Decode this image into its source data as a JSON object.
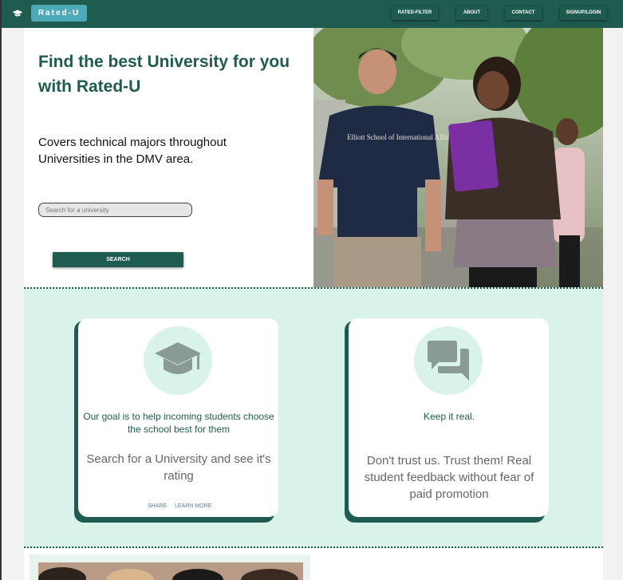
{
  "nav": {
    "brand": "Rated-U",
    "items": [
      "RATED-FILTER",
      "ABOUT",
      "CONTACT",
      "SIGNUP/LOGIN"
    ]
  },
  "hero": {
    "title": "Find the best University for you with Rated-U",
    "subtitle": "Covers technical majors throughout Universities in the DMV area.",
    "search_placeholder": "Search for a university",
    "search_button": "SEARCH",
    "photo_shirt_text": "Elliott School of International Affairs"
  },
  "cards": [
    {
      "icon": "graduation-cap-icon",
      "heading": "Our goal is to help incoming students choose the school best for them",
      "body": "Search for a University and see it's rating",
      "links": [
        "SHARE",
        "LEARN MORE"
      ]
    },
    {
      "icon": "chat-bubbles-icon",
      "heading": "Keep it real.",
      "body": "Don't trust us. Trust them! Real student feedback without fear of paid promotion"
    }
  ],
  "colors": {
    "primary": "#1f5b4f",
    "brand_badge": "#4eaab8",
    "band": "#d9f2ea"
  }
}
